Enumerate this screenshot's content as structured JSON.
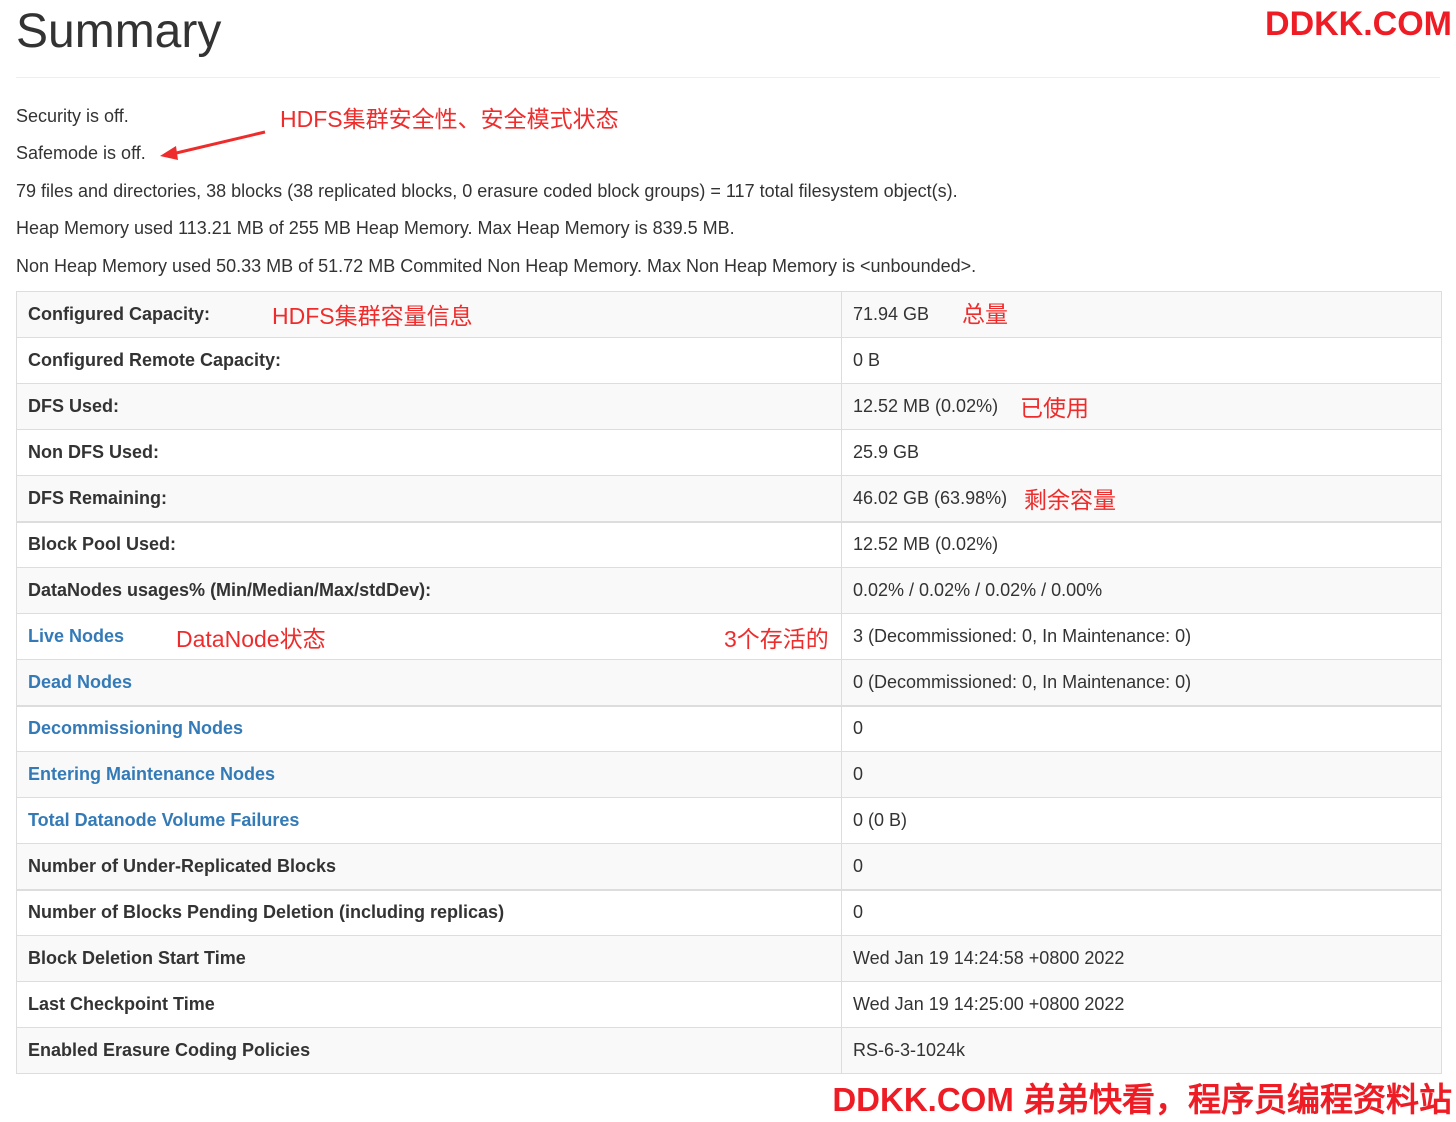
{
  "page": {
    "title": "Summary",
    "watermark_top": "DDKK.COM",
    "watermark_bottom": "DDKK.COM 弟弟快看，程序员编程资料站"
  },
  "status": {
    "security": "Security is off.",
    "safemode": "Safemode is off.",
    "objects": "79 files and directories, 38 blocks (38 replicated blocks, 0 erasure coded block groups) = 117 total filesystem object(s).",
    "heap": "Heap Memory used 113.21 MB of 255 MB Heap Memory. Max Heap Memory is 839.5 MB.",
    "non_heap": "Non Heap Memory used 50.33 MB of 51.72 MB Commited Non Heap Memory. Max Non Heap Memory is <unbounded>."
  },
  "annotations": {
    "security_note": "HDFS集群安全性、安全模式状态",
    "capacity_note": "HDFS集群容量信息",
    "total_note": "总量",
    "used_note": "已使用",
    "remaining_note": "剩余容量",
    "datanode_note": "DataNode状态",
    "alive_note": "3个存活的"
  },
  "table": {
    "rows": [
      {
        "label": "Configured Capacity:",
        "value": "71.94 GB"
      },
      {
        "label": "Configured Remote Capacity:",
        "value": "0 B"
      },
      {
        "label": "DFS Used:",
        "value": "12.52 MB (0.02%)"
      },
      {
        "label": "Non DFS Used:",
        "value": "25.9 GB"
      },
      {
        "label": "DFS Remaining:",
        "value": "46.02 GB (63.98%)"
      },
      {
        "label": "Block Pool Used:",
        "value": "12.52 MB (0.02%)"
      },
      {
        "label": "DataNodes usages% (Min/Median/Max/stdDev):",
        "value": "0.02% / 0.02% / 0.02% / 0.00%"
      },
      {
        "label": "Live Nodes",
        "value": "3 (Decommissioned: 0, In Maintenance: 0)"
      },
      {
        "label": "Dead Nodes",
        "value": "0 (Decommissioned: 0, In Maintenance: 0)"
      },
      {
        "label": "Decommissioning Nodes",
        "value": "0"
      },
      {
        "label": "Entering Maintenance Nodes",
        "value": "0"
      },
      {
        "label": "Total Datanode Volume Failures",
        "value": "0 (0 B)"
      },
      {
        "label": "Number of Under-Replicated Blocks",
        "value": "0"
      },
      {
        "label": "Number of Blocks Pending Deletion (including replicas)",
        "value": "0"
      },
      {
        "label": "Block Deletion Start Time",
        "value": "Wed Jan 19 14:24:58 +0800 2022"
      },
      {
        "label": "Last Checkpoint Time",
        "value": "Wed Jan 19 14:25:00 +0800 2022"
      },
      {
        "label": "Enabled Erasure Coding Policies",
        "value": "RS-6-3-1024k"
      }
    ]
  },
  "colors": {
    "link": "#337ab7",
    "annotation": "#ee2c2c",
    "watermark": "#ee1c25",
    "text": "#333333",
    "stripe": "#f9f9f9",
    "border": "#dddddd"
  }
}
